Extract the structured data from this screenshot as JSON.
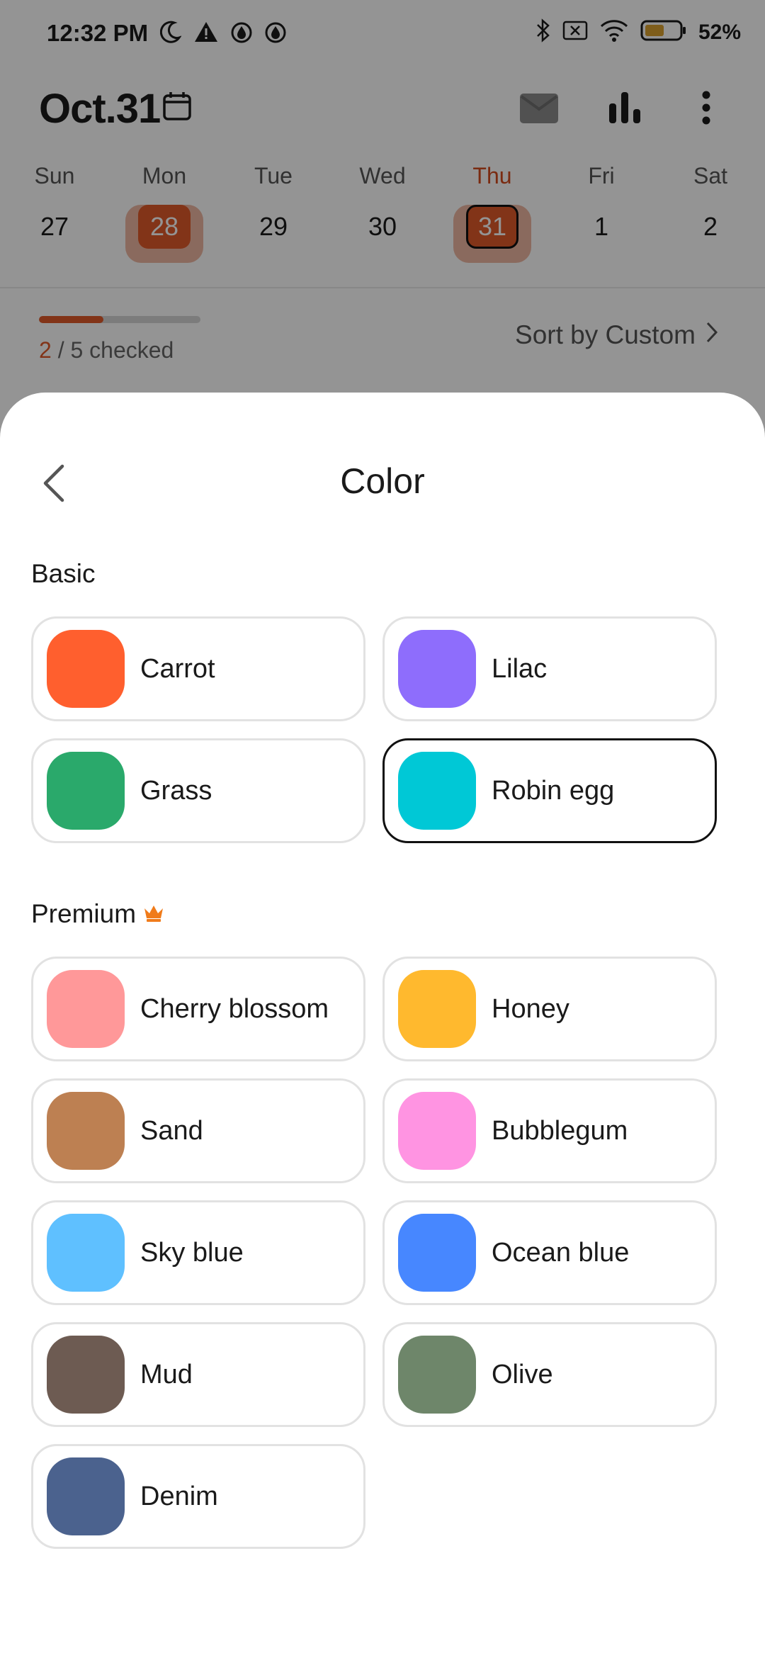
{
  "status_bar": {
    "time": "12:32 PM",
    "battery_percent": "52%"
  },
  "header": {
    "date_title": "Oct.31"
  },
  "week": [
    {
      "name": "Sun",
      "num": "27",
      "state": "normal"
    },
    {
      "name": "Mon",
      "num": "28",
      "state": "filled"
    },
    {
      "name": "Tue",
      "num": "29",
      "state": "normal"
    },
    {
      "name": "Wed",
      "num": "30",
      "state": "normal"
    },
    {
      "name": "Thu",
      "num": "31",
      "state": "today"
    },
    {
      "name": "Fri",
      "num": "1",
      "state": "normal"
    },
    {
      "name": "Sat",
      "num": "2",
      "state": "normal"
    }
  ],
  "progress": {
    "done": "2",
    "rest": " / 5 checked",
    "fraction": 0.4
  },
  "sort": {
    "label": "Sort by Custom"
  },
  "sheet": {
    "title": "Color",
    "basic_label": "Basic",
    "premium_label": "Premium",
    "basic_colors": [
      {
        "name": "Carrot",
        "hex": "#ff5f2e"
      },
      {
        "name": "Lilac",
        "hex": "#8e6dfc"
      },
      {
        "name": "Grass",
        "hex": "#2aa96b"
      },
      {
        "name": "Robin egg",
        "hex": "#00c8d6",
        "selected": true
      }
    ],
    "premium_colors": [
      {
        "name": "Cherry blossom",
        "hex": "#ff9899"
      },
      {
        "name": "Honey",
        "hex": "#ffb92e"
      },
      {
        "name": "Sand",
        "hex": "#bd8052"
      },
      {
        "name": "Bubblegum",
        "hex": "#ff94e2"
      },
      {
        "name": "Sky blue",
        "hex": "#5fc0ff"
      },
      {
        "name": "Ocean blue",
        "hex": "#4787ff"
      },
      {
        "name": "Mud",
        "hex": "#6d5b52"
      },
      {
        "name": "Olive",
        "hex": "#6e866a"
      },
      {
        "name": "Denim",
        "hex": "#4b628e"
      }
    ]
  },
  "colors": {
    "accent": "#e15a2a",
    "crown": "#f07b1a",
    "selected_border": "#111111"
  }
}
